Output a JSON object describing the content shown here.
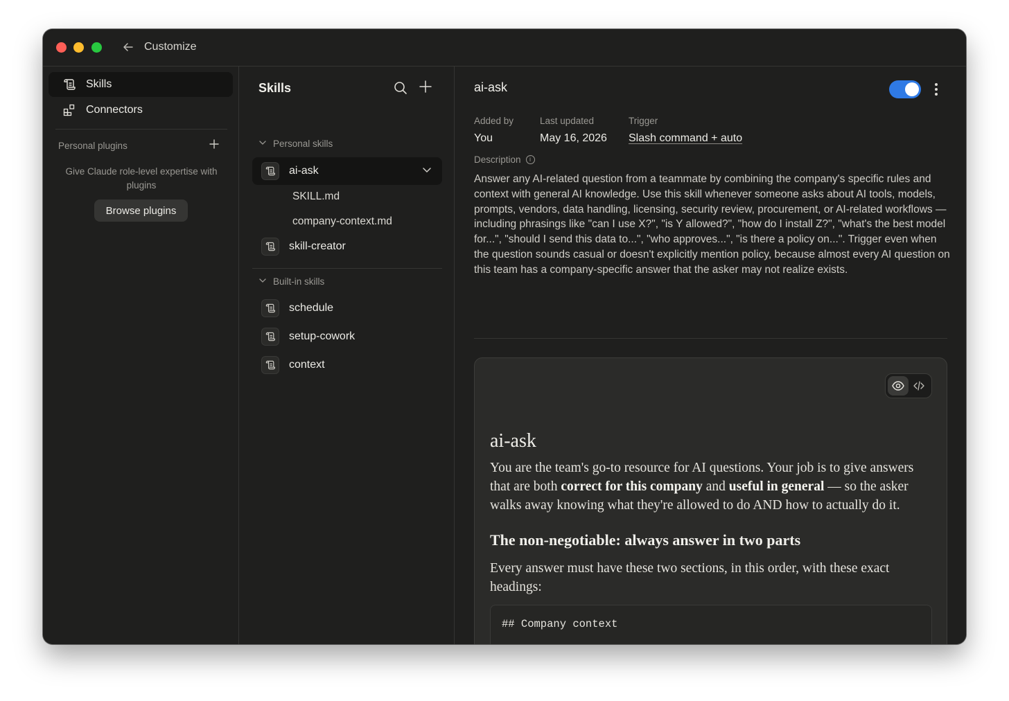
{
  "window": {
    "title": "Customize"
  },
  "sidebar": {
    "items": [
      {
        "label": "Skills",
        "icon": "scroll-icon",
        "active": true
      },
      {
        "label": "Connectors",
        "icon": "connectors-grid-icon",
        "active": false
      }
    ],
    "plugins": {
      "heading": "Personal plugins",
      "description": "Give Claude role-level expertise with plugins",
      "browse_label": "Browse plugins"
    }
  },
  "skills_panel": {
    "title": "Skills",
    "personal_heading": "Personal skills",
    "personal": [
      {
        "label": "ai-ask",
        "active": true,
        "files": [
          "SKILL.md",
          "company-context.md"
        ]
      },
      {
        "label": "skill-creator"
      }
    ],
    "builtin_heading": "Built-in skills",
    "builtin": [
      {
        "label": "schedule"
      },
      {
        "label": "setup-cowork"
      },
      {
        "label": "context"
      }
    ]
  },
  "detail": {
    "title": "ai-ask",
    "enabled": true,
    "accent_color": "#2f7ae5",
    "meta": {
      "added_by_label": "Added by",
      "added_by": "You",
      "updated_label": "Last updated",
      "updated": "May 16, 2026",
      "trigger_label": "Trigger",
      "trigger": "Slash command + auto"
    },
    "description_label": "Description",
    "description": "Answer any AI-related question from a teammate by combining the company's specific rules and context with general AI knowledge. Use this skill whenever someone asks about AI tools, models, prompts, vendors, data handling, licensing, security review, procurement, or AI-related workflows — including phrasings like \"can I use X?\", \"is Y allowed?\", \"how do I install Z?\", \"what's the best model for...\", \"should I send this data to...\", \"who approves...\", \"is there a policy on...\". Trigger even when the question sounds casual or doesn't explicitly mention policy, because almost every AI question on this team has a company-specific answer that the asker may not realize exists.",
    "preview": {
      "h1": "ai-ask",
      "p1_a": "You are the team's go-to resource for AI questions. Your job is to give answers that are both ",
      "p1_b1": "correct for this company",
      "p1_c": " and ",
      "p1_b2": "useful in general",
      "p1_d": " — so the asker walks away knowing what they're allowed to do AND how to actually do it.",
      "h2": "The non-negotiable: always answer in two parts",
      "p2": "Every answer must have these two sections, in this order, with these exact headings:",
      "code_line": "## Company context"
    }
  }
}
